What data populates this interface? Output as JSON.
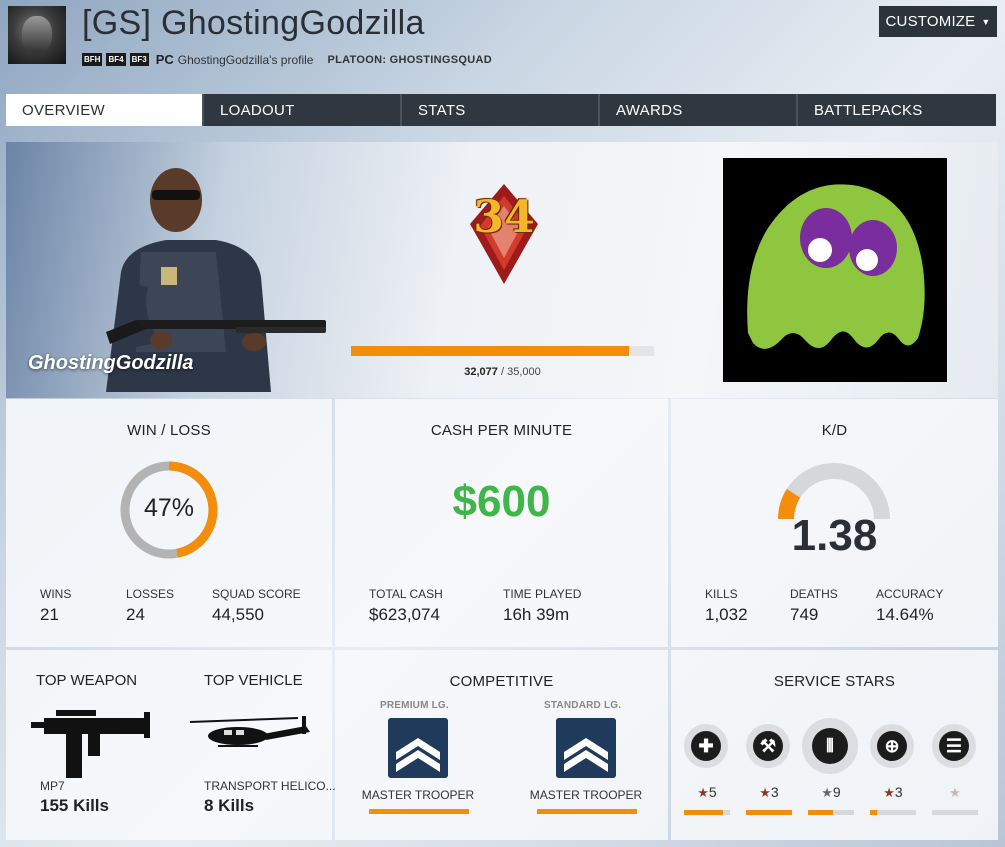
{
  "header": {
    "title": "[GS] GhostingGodzilla",
    "game_badges": [
      "BFH",
      "BF4",
      "BF3"
    ],
    "platform": "PC",
    "profile_text": "GhostingGodzilla's profile",
    "platoon_label": "PLATOON: GHOSTINGSQUAD",
    "customize_label": "CUSTOMIZE"
  },
  "tabs": [
    {
      "label": "OVERVIEW",
      "active": true
    },
    {
      "label": "LOADOUT",
      "active": false
    },
    {
      "label": "STATS",
      "active": false
    },
    {
      "label": "AWARDS",
      "active": false
    },
    {
      "label": "BATTLEPACKS",
      "active": false
    }
  ],
  "hero": {
    "soldier_name": "GhostingGodzilla",
    "rank": "34",
    "xp_current": "32,077",
    "xp_total": "35,000",
    "xp_progress": 0.9165
  },
  "win_loss": {
    "title": "WIN / LOSS",
    "percent_text": "47%",
    "percent": 0.47,
    "wins_label": "WINS",
    "wins": "21",
    "losses_label": "LOSSES",
    "losses": "24",
    "squad_label": "SQUAD SCORE",
    "squad_score": "44,550"
  },
  "cash": {
    "title": "CASH PER MINUTE",
    "value": "$600",
    "total_label": "TOTAL CASH",
    "total": "$623,074",
    "time_label": "TIME PLAYED",
    "time": "16h 39m"
  },
  "kd": {
    "title": "K/D",
    "value": "1.38",
    "gauge_fraction": 0.18,
    "kills_label": "KILLS",
    "kills": "1,032",
    "deaths_label": "DEATHS",
    "deaths": "749",
    "accuracy_label": "ACCURACY",
    "accuracy": "14.64%"
  },
  "top": {
    "weapon_title": "TOP WEAPON",
    "vehicle_title": "TOP VEHICLE",
    "weapon_name": "MP7",
    "weapon_kills": "155 Kills",
    "vehicle_name": "TRANSPORT HELICO...",
    "vehicle_kills": "8 Kills"
  },
  "competitive": {
    "title": "COMPETITIVE",
    "premium_label": "PREMIUM LG.",
    "standard_label": "STANDARD LG.",
    "premium_rank": "MASTER TROOPER",
    "standard_rank": "MASTER TROOPER"
  },
  "service_stars": {
    "title": "SERVICE STARS",
    "items": [
      {
        "icon": "medic-cross-icon",
        "glyph": "✚",
        "count": "5",
        "progress": 0.85,
        "star_color": "#8a3a2a"
      },
      {
        "icon": "wrench-icon",
        "glyph": "⚒",
        "count": "3",
        "progress": 1.0,
        "star_color": "#8a3a2a"
      },
      {
        "icon": "ammo-icon",
        "glyph": "⦀",
        "count": "9",
        "progress": 0.55,
        "star_color": "#666666"
      },
      {
        "icon": "crosshair-icon",
        "glyph": "⊕",
        "count": "3",
        "progress": 0.15,
        "star_color": "#8a3a2a"
      },
      {
        "icon": "commander-icon",
        "glyph": "☰",
        "count": "",
        "progress": 0.0,
        "star_color": "#c8b8b0"
      }
    ]
  },
  "colors": {
    "accent": "#f38d0c",
    "cash_green": "#3fb54a",
    "dark": "#2f3740"
  }
}
